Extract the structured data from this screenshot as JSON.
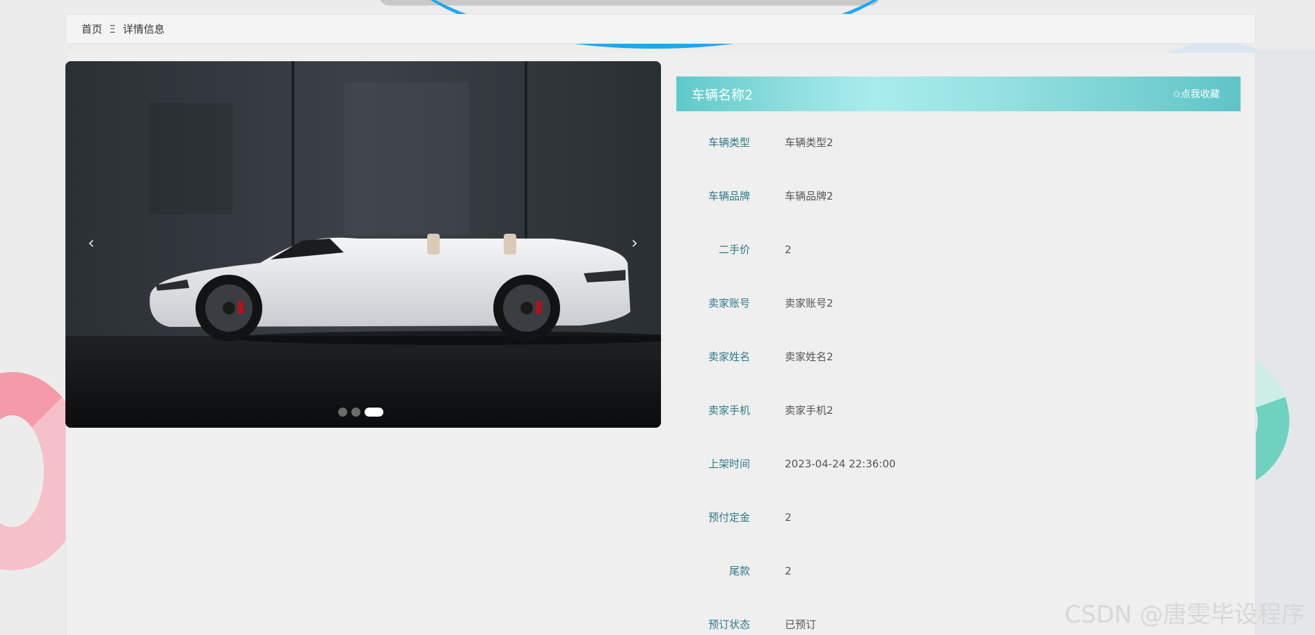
{
  "breadcrumb": {
    "home": "首页",
    "separator": "Ξ",
    "current": "详情信息"
  },
  "carousel": {
    "prev_icon": "chevron-left-icon",
    "prev_glyph": "‹",
    "next_icon": "chevron-right-icon",
    "next_glyph": "›",
    "dot_count": 3,
    "active_index": 2
  },
  "detail": {
    "title": "车辆名称2",
    "favorite_label": "✩点我收藏",
    "fields": [
      {
        "label": "车辆类型",
        "value": "车辆类型2"
      },
      {
        "label": "车辆品牌",
        "value": "车辆品牌2"
      },
      {
        "label": "二手价",
        "value": "2"
      },
      {
        "label": "卖家账号",
        "value": "卖家账号2"
      },
      {
        "label": "卖家姓名",
        "value": "卖家姓名2"
      },
      {
        "label": "卖家手机",
        "value": "卖家手机2"
      },
      {
        "label": "上架时间",
        "value": "2023-04-24 22:36:00"
      },
      {
        "label": "预付定金",
        "value": "2"
      },
      {
        "label": "尾款",
        "value": "2"
      },
      {
        "label": "预订状态",
        "value": "已预订"
      }
    ]
  },
  "watermark": "CSDN @唐雯毕设程序",
  "colors": {
    "accent": "#5ec9c9",
    "label": "#2f7a86",
    "value": "#555555",
    "watermark": "#d7d7d7"
  }
}
